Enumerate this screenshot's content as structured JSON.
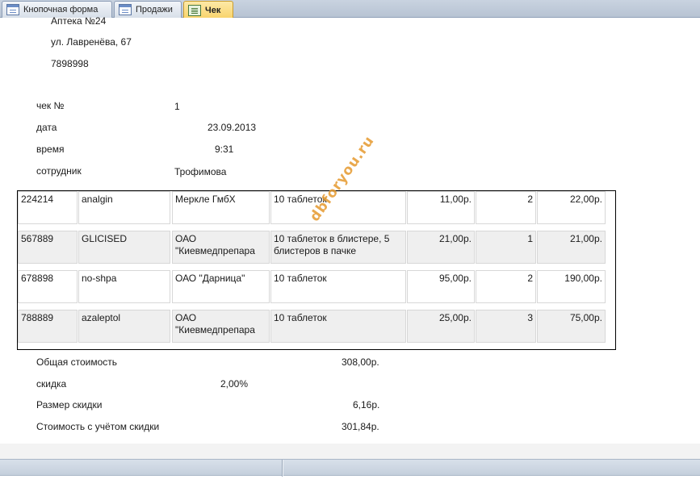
{
  "tabs": [
    {
      "label": "Кнопочная форма",
      "icon": "form-icon"
    },
    {
      "label": "Продажи",
      "icon": "form-icon"
    },
    {
      "label": "Чек",
      "icon": "report-icon"
    }
  ],
  "header": {
    "pharmacy": "Аптека  №24",
    "address": "ул. Лавренёва, 67",
    "phone": "7898998"
  },
  "receipt": {
    "check_label": "чек №",
    "check_value": "1",
    "date_label": "дата",
    "date_value": "23.09.2013",
    "time_label": "время",
    "time_value": "9:31",
    "employee_label": "сотрудник",
    "employee_value": "Трофимова"
  },
  "items": [
    {
      "code": "224214",
      "name": "analgin",
      "maker": "Меркле ГмбХ",
      "package": "10 таблеток",
      "price": "11,00р.",
      "qty": "2",
      "sum": "22,00р."
    },
    {
      "code": "567889",
      "name": "GLICISED",
      "maker": "ОАО \"Киевмедпрепара",
      "package": "10 таблеток в блистере, 5 блистеров в пачке",
      "price": "21,00р.",
      "qty": "1",
      "sum": "21,00р."
    },
    {
      "code": "678898",
      "name": "no-shpa",
      "maker": "ОАО \"Дарница\"",
      "package": "10 таблеток",
      "price": "95,00р.",
      "qty": "2",
      "sum": "190,00р."
    },
    {
      "code": "788889",
      "name": "azaleptol",
      "maker": "ОАО \"Киевмедпрепара",
      "package": "10 таблеток",
      "price": "25,00р.",
      "qty": "3",
      "sum": "75,00р."
    }
  ],
  "totals": {
    "total_label": "Общая стоимость",
    "total_value": "308,00р.",
    "discount_label": "скидка",
    "discount_value": "2,00%",
    "discount_amount_label": "Размер скидки",
    "discount_amount_value": "6,16р.",
    "final_label": "Стоимость с учётом скидки",
    "final_value": "301,84р."
  },
  "watermark": "dbforyou.ru"
}
